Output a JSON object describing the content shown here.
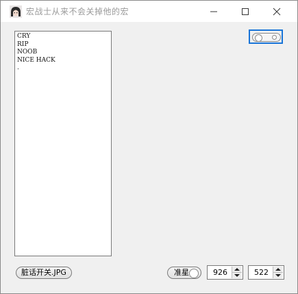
{
  "window": {
    "title": "宏战士从来不会关掉他的宏",
    "controls": [
      "minimize",
      "maximize",
      "close"
    ]
  },
  "listbox": {
    "items": [
      "CRY",
      "RIP",
      "NOOB",
      "NICE HACK",
      "."
    ]
  },
  "toggle": {
    "state": "off"
  },
  "buttons": {
    "emote_label": "脏话开关.JPG",
    "aim_label": "准星"
  },
  "spinners": {
    "x_value": "926",
    "y_value": "522"
  },
  "colors": {
    "focus_border": "#1874d8",
    "background": "#f0f0f0"
  }
}
